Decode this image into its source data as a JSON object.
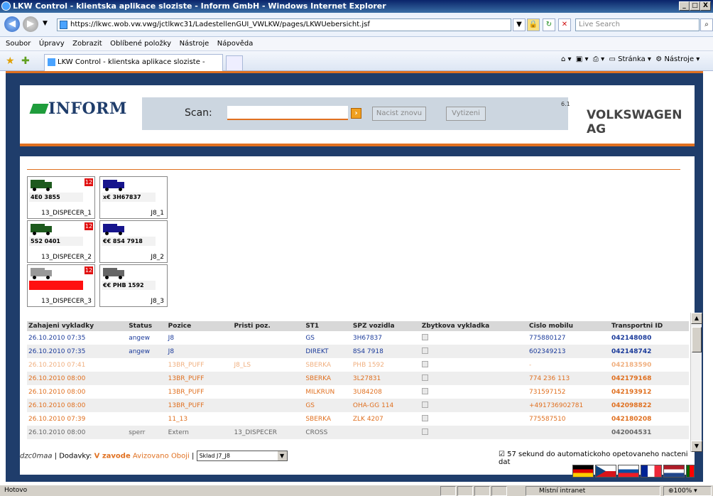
{
  "window": {
    "title": "LKW Control - klientska aplikace sloziste - Inform GmbH - Windows Internet Explorer"
  },
  "address": {
    "url": "https://lkwc.wob.vw.vwg/jctlkwc31/LadestellenGUI_VWLKW/pages/LKWUebersicht.jsf",
    "search_placeholder": "Live Search"
  },
  "menu": [
    "Soubor",
    "Úpravy",
    "Zobrazit",
    "Oblíbené položky",
    "Nástroje",
    "Nápověda"
  ],
  "tab": {
    "label": "LKW Control - klientska aplikace sloziste - Inform GmbH",
    "page_label": "Stránka",
    "tools_label": "Nástroje"
  },
  "header": {
    "logo": "INFORM",
    "scan_label": "Scan:",
    "reload_button": "Nacist znovu",
    "unload_button": "Vytizeni",
    "version": "6.1",
    "company": "VOLKSWAGEN AG"
  },
  "tiles": [
    {
      "plate": "4E0 3855",
      "caption": "13_DISPECER_1",
      "badge": "12",
      "color": "#1d5a1d"
    },
    {
      "plate": "x€ 3H67837",
      "caption": "J8_1",
      "badge": "",
      "color": "#16148c"
    },
    {
      "plate": "5S2 0401",
      "caption": "13_DISPECER_2",
      "badge": "12",
      "color": "#1d5a1d"
    },
    {
      "plate": "€€ 8S4 7918",
      "caption": "J8_2",
      "badge": "",
      "color": "#16148c"
    },
    {
      "plate": "",
      "caption": "13_DISPECER_3",
      "badge": "12",
      "color": "#999999"
    },
    {
      "plate": "€€ PHB 1592",
      "caption": "J8_3",
      "badge": "",
      "color": "#666666"
    }
  ],
  "table": {
    "columns": [
      "Zahajeni vykladky",
      "Status",
      "Pozice",
      "Pristi poz.",
      "ST1",
      "SPZ vozidla",
      "Zbytkova vykladka",
      "Cislo mobilu",
      "Transportni ID"
    ],
    "rows": [
      {
        "cells": [
          "26.10.2010 07:35",
          "angew",
          "J8",
          "",
          "GS",
          "3H67837",
          "",
          "775880127",
          "042148080"
        ],
        "color": "#1a3a9a"
      },
      {
        "cells": [
          "26.10.2010 07:35",
          "angew",
          "J8",
          "",
          "DIREKT",
          "8S4 7918",
          "",
          "602349213",
          "042148742"
        ],
        "color": "#1a3a9a"
      },
      {
        "cells": [
          "26.10.2010 07:41",
          "",
          "13BR_PUFF",
          "J8_LS",
          "SBERKA",
          "PHB 1592",
          "",
          "-",
          "042183590"
        ],
        "color": "#f0b080"
      },
      {
        "cells": [
          "26.10.2010 08:00",
          "",
          "13BR_PUFF",
          "",
          "SBERKA",
          "3L27831",
          "",
          "774 236 113",
          "042179168"
        ],
        "color": "#e07020"
      },
      {
        "cells": [
          "26.10.2010 08:00",
          "",
          "13BR_PUFF",
          "",
          "MILKRUN",
          "3U84208",
          "",
          "731597152",
          "042193912"
        ],
        "color": "#e07020"
      },
      {
        "cells": [
          "26.10.2010 08:00",
          "",
          "13BR_PUFF",
          "",
          "GS",
          "OHA-GG 114",
          "",
          "+491736902781",
          "042098822"
        ],
        "color": "#e07020"
      },
      {
        "cells": [
          "26.10.2010 07:39",
          "",
          "11_13",
          "",
          "SBERKA",
          "ZLK 4207",
          "",
          "775587510",
          "042180208"
        ],
        "color": "#e07020"
      },
      {
        "cells": [
          "26.10.2010 08:00",
          "sperr",
          "Extern",
          "13_DISPECER",
          "CROSS",
          "",
          "",
          "",
          "042004531"
        ],
        "color": "#666666"
      }
    ]
  },
  "footer": {
    "user": "dzc0maa",
    "sep1": " | ",
    "deliveries": "Dodavky:",
    "in_plant": "V zavode",
    "announced": "Avizovano",
    "both": "Oboji",
    "sep2": " | ",
    "store": "Sklad J7_J8",
    "auto_reload": "57 sekund do automatickoho opetovaneho nacteni dat"
  },
  "status": {
    "text": "Hotovo",
    "zone": "Místní intranet",
    "zoom": "100%"
  }
}
